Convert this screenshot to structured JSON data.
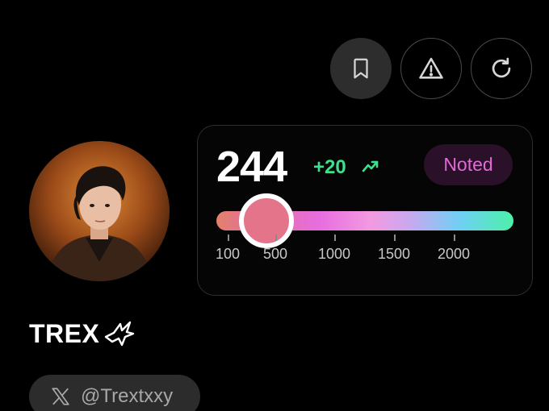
{
  "toolbar": {
    "bookmark_icon": "bookmark-icon",
    "report_icon": "warning-triangle-icon",
    "refresh_icon": "refresh-icon"
  },
  "profile": {
    "name": "TREX",
    "handle": "@Trextxxy",
    "name_badge_icon": "bird-logo-icon",
    "handle_icon": "x-logo-icon"
  },
  "score_card": {
    "score": "244",
    "delta": "+20",
    "trend_icon": "trending-up-icon",
    "status_badge": "Noted",
    "slider": {
      "value": 244,
      "tick_labels": [
        "100",
        "500",
        "1000",
        "1500",
        "2000"
      ]
    }
  },
  "colors": {
    "positive": "#3ee08a",
    "badge_text": "#e06ad6",
    "thumb": "#e3748a"
  }
}
